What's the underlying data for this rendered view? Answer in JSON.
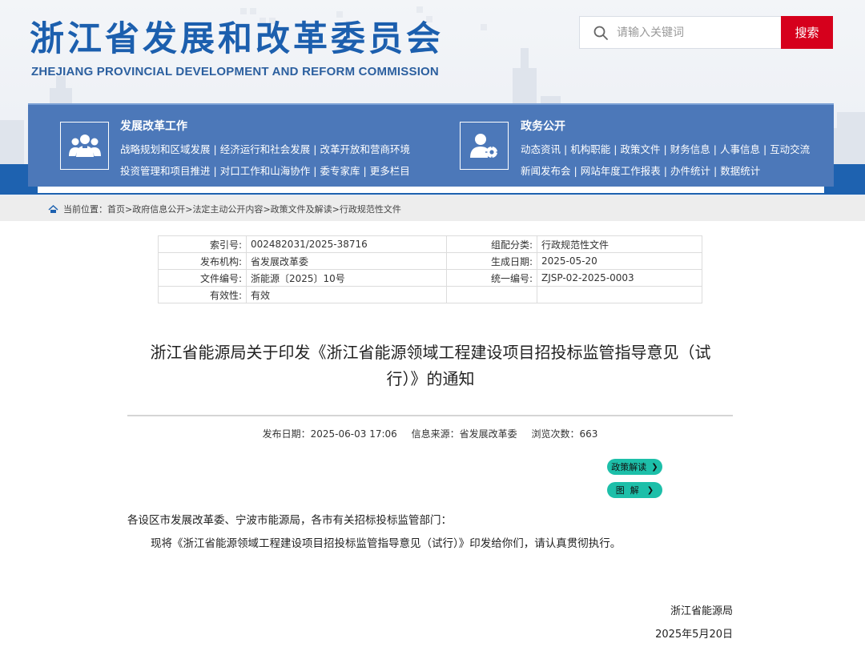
{
  "header": {
    "title": "浙江省发展和改革委员会",
    "subtitle": "ZHEJIANG PROVINCIAL DEVELOPMENT AND REFORM COMMISSION",
    "search_placeholder": "请输入关键词",
    "search_button": "搜索",
    "brand_color": "#1c5fae",
    "search_button_color": "#d6001c"
  },
  "nav": {
    "groups": [
      {
        "title": "发展改革工作",
        "icon": "people-icon",
        "lines": [
          [
            "战略规划和区域发展",
            "经济运行和社会发展",
            "改革开放和营商环境"
          ],
          [
            "投资管理和项目推进",
            "对口工作和山海协作",
            "委专家库",
            "更多栏目"
          ]
        ]
      },
      {
        "title": "政务公开",
        "icon": "user-gear-icon",
        "lines": [
          [
            "动态资讯",
            "机构职能",
            "政策文件",
            "财务信息",
            "人事信息",
            "互动交流"
          ],
          [
            "新闻发布会",
            "网站年度工作报表",
            "办件统计",
            "数据统计"
          ]
        ]
      }
    ],
    "separator": "|"
  },
  "breadcrumb": {
    "label": "当前位置：",
    "items": [
      "首页",
      "政府信息公开",
      "法定主动公开内容",
      "政策文件及解读",
      "行政规范性文件"
    ],
    "separator": ">"
  },
  "meta": {
    "rows": [
      {
        "k1": "索引号:",
        "v1": "002482031/2025-38716",
        "k2": "组配分类:",
        "v2": "行政规范性文件"
      },
      {
        "k1": "发布机构:",
        "v1": "省发展改革委",
        "k2": "生成日期:",
        "v2": "2025-05-20"
      },
      {
        "k1": "文件编号:",
        "v1": "浙能源〔2025〕10号",
        "k2": "统一编号:",
        "v2": "ZJSP-02-2025-0003"
      },
      {
        "k1": "有效性:",
        "v1": "有效",
        "k2": "",
        "v2": ""
      }
    ]
  },
  "article": {
    "title_line1": "浙江省能源局关于印发《浙江省能源领域工程建设项目招投标监管指导意见（试",
    "title_line2": "行）》的通知",
    "publish_date": "发布日期：2025-06-03 17:06",
    "source": "信息来源：省发展改革委",
    "views": "浏览次数：663",
    "tag_policy": "政策解读",
    "tag_graphic": "图  解",
    "tag_color": "#1dbfa9",
    "salutation": "各设区市发展改革委、宁波市能源局，各市有关招标投标监管部门：",
    "body": "现将《浙江省能源领域工程建设项目招投标监管指导意见（试行）》印发给你们，请认真贯彻执行。",
    "signer": "浙江省能源局",
    "sign_date": "2025年5月20日"
  }
}
